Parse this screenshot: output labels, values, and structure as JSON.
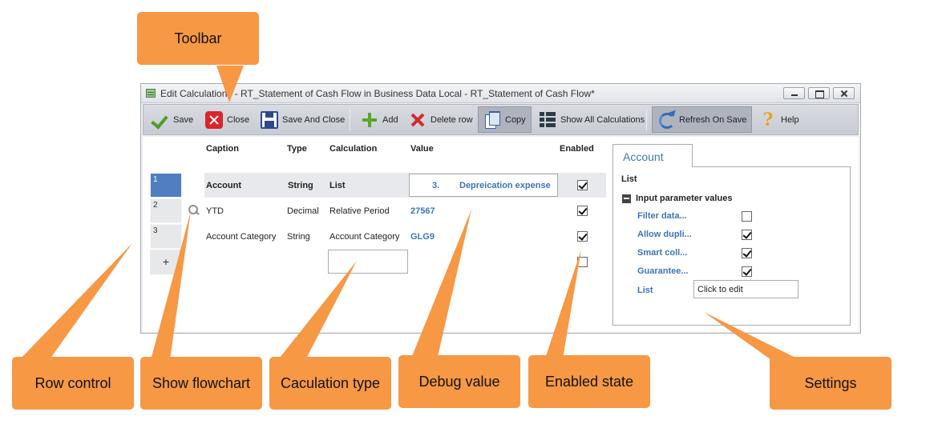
{
  "window": {
    "title": "Edit Calculations - RT_Statement of Cash Flow in Business Data Local - RT_Statement of Cash Flow*"
  },
  "toolbar": {
    "save": "Save",
    "close": "Close",
    "save_and_close": "Save And Close",
    "add": "Add",
    "delete_row": "Delete row",
    "copy": "Copy",
    "show_all": "Show All Calculations",
    "refresh_on_save": "Refresh On Save",
    "help": "Help"
  },
  "grid": {
    "headers": {
      "caption": "Caption",
      "type": "Type",
      "calculation": "Calculation",
      "value": "Value",
      "enabled": "Enabled"
    },
    "rows": [
      {
        "num": "1",
        "caption": "Account",
        "type": "String",
        "calculation": "List",
        "value_index": "3.",
        "value": "Depreication expense",
        "enabled": true
      },
      {
        "num": "2",
        "caption": "YTD",
        "type": "Decimal",
        "calculation": "Relative Period",
        "value": "27567",
        "enabled": true
      },
      {
        "num": "3",
        "caption": "Account Category",
        "type": "String",
        "calculation": "Account Category",
        "value": "GLG9",
        "enabled": true
      }
    ],
    "new_row_enabled": false,
    "add_row_label": "+"
  },
  "settings": {
    "tab": "Account",
    "section": "List",
    "group": "Input parameter values",
    "properties": [
      {
        "label": "Filter data...",
        "checked": false
      },
      {
        "label": "Allow dupli...",
        "checked": true
      },
      {
        "label": "Smart coll...",
        "checked": true
      },
      {
        "label": "Guarantee...",
        "checked": true
      }
    ],
    "list_label": "List",
    "list_value": "Click to edit"
  },
  "callouts": {
    "toolbar": "Toolbar",
    "row_control": "Row control",
    "show_flowchart": "Show flowchart",
    "calculation_type": "Caculation type",
    "debug_value": "Debug value",
    "enabled_state": "Enabled state",
    "settings": "Settings"
  },
  "colors": {
    "callout": "#f79845",
    "accent_blue": "#3d75b7",
    "row_selected": "#4f7fc0"
  }
}
